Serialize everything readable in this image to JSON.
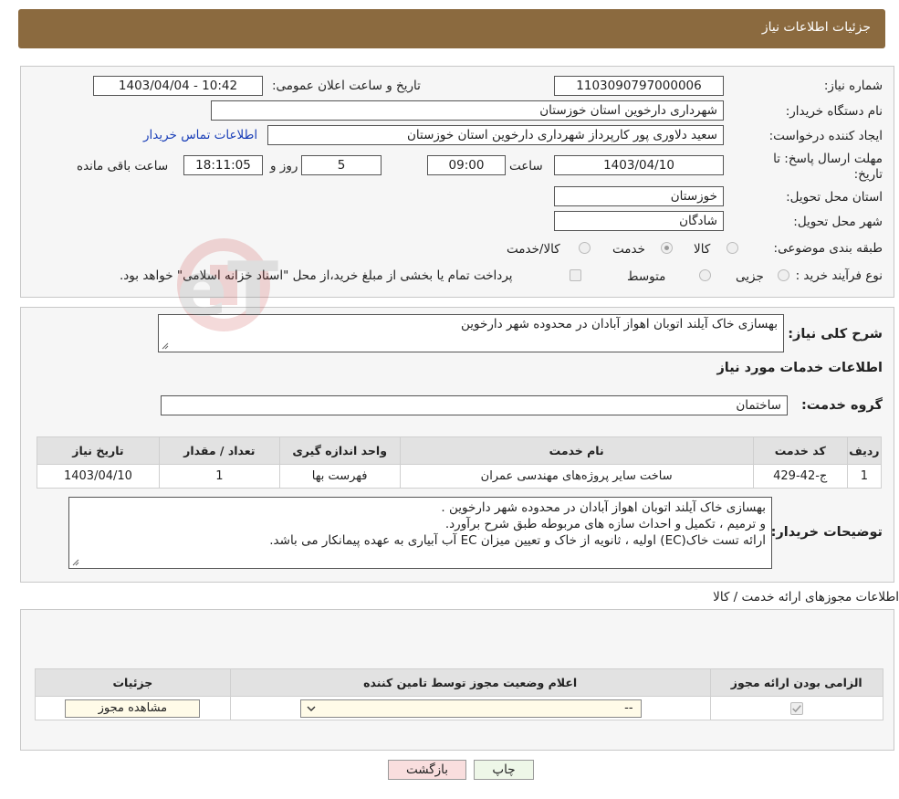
{
  "header": {
    "title": "جزئیات اطلاعات نیاز"
  },
  "form": {
    "need_number_label": "شماره نیاز:",
    "need_number": "1103090797000006",
    "announce_label": "تاریخ و ساعت اعلان عمومی:",
    "announce_value": "1403/04/04 - 10:42",
    "buyer_org_label": "نام دستگاه خریدار:",
    "buyer_org": "شهرداری دارخوین استان خوزستان",
    "creator_label": "ایجاد کننده درخواست:",
    "creator": "سعید دلاوری پور کارپرداز شهرداری دارخوین استان خوزستان",
    "contact_link": "اطلاعات تماس خریدار",
    "deadline_label_1": "مهلت ارسال پاسخ: تا",
    "deadline_label_2": "تاریخ:",
    "deadline_date": "1403/04/10",
    "time_label": "ساعت",
    "deadline_time": "09:00",
    "days_value": "5",
    "days_label": "روز و",
    "remaining_time": "18:11:05",
    "remaining_label": "ساعت باقی مانده",
    "province_label": "استان محل تحویل:",
    "province": "خوزستان",
    "city_label": "شهر محل تحویل:",
    "city": "شادگان",
    "category_label": "طبقه بندی موضوعی:",
    "category_options": [
      "کالا",
      "خدمت",
      "کالا/خدمت"
    ],
    "process_label": "نوع فرآیند خرید :",
    "process_options": [
      "جزیی",
      "متوسط"
    ],
    "process_note": "پرداخت تمام یا بخشی از مبلغ خرید،از محل \"اسناد خزانه اسلامی\" خواهد بود."
  },
  "summary": {
    "label": "شرح کلی نیاز:",
    "text": "بهسازی خاک آیلند اتوبان اهواز آبادان در محدوده شهر دارخوین",
    "services_heading": "اطلاعات خدمات مورد نیاز",
    "group_label": "گروه خدمت:",
    "group_value": "ساختمان"
  },
  "services_table": {
    "headers": [
      "ردیف",
      "کد خدمت",
      "نام خدمت",
      "واحد اندازه گیری",
      "تعداد / مقدار",
      "تاریخ نیاز"
    ],
    "rows": [
      [
        "1",
        "ج-42-429",
        "ساخت سایر پروژه‌های مهندسی عمران",
        "فهرست بها",
        "1",
        "1403/04/10"
      ]
    ]
  },
  "buyer_notes": {
    "label": "توضیحات خریدار:",
    "lines": [
      "بهسازی خاک آیلند اتوبان اهواز آبادان در محدوده شهر دارخوین .",
      "و ترمیم ، تکمیل و احداث سازه های مربوطه طبق شرح برآورد.",
      "ارائه تست خاک(EC) اولیه ، ثانویه از خاک و تعیین میزان EC آب آبیاری به عهده پیمانکار می باشد."
    ]
  },
  "permits": {
    "heading": "اطلاعات مجوزهای ارائه خدمت / کالا",
    "headers": [
      "الزامی بودن ارائه مجوز",
      "اعلام وضعیت مجوز توسط تامین کننده",
      "جزئیات"
    ],
    "select_value": "--",
    "view_button": "مشاهده مجوز"
  },
  "footer": {
    "print_button": "چاپ",
    "back_button": "بازگشت"
  },
  "watermark": {
    "text": "AriaTender.neT"
  },
  "colors": {
    "header_bg": "#8b6a3f",
    "link": "#1a3fb8",
    "back_btn_bg": "#f9dede",
    "print_btn_bg": "#eef7e8"
  }
}
